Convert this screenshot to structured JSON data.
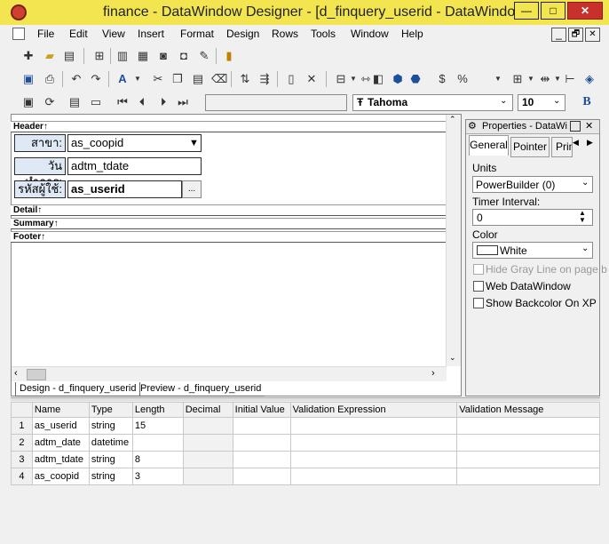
{
  "window": {
    "title": "finance - DataWindow Designer - [d_finquery_userid  - DataWindow]",
    "min_label": "—",
    "max_label": "□",
    "close_label": "✕"
  },
  "menu": {
    "items": [
      "File",
      "Edit",
      "View",
      "Insert",
      "Format",
      "Design",
      "Rows",
      "Tools",
      "Window",
      "Help"
    ],
    "child_min": "_",
    "child_restore": "🗗",
    "child_close": "✕"
  },
  "toolbar": {
    "font_name": "Tahoma",
    "font_size": "10",
    "bold_label": "B"
  },
  "bands": {
    "header": "Header↑",
    "detail": "Detail↑",
    "summary": "Summary↑",
    "footer": "Footer↑"
  },
  "header_fields": [
    {
      "label": "สาขา:",
      "value": "as_coopid"
    },
    {
      "label": "วันทำการ:",
      "value": "adtm_tdate"
    },
    {
      "label": "รหัสผู้ใช้:",
      "value": "as_userid",
      "button": "..."
    }
  ],
  "tabs": {
    "design": "Design - d_finquery_userid",
    "preview": "Preview - d_finquery_userid"
  },
  "properties": {
    "title": "Properties - DataWi",
    "tabs": [
      "General",
      "Pointer",
      "Prin"
    ],
    "units_label": "Units",
    "units_value": "PowerBuilder (0)",
    "timer_label": "Timer Interval:",
    "timer_value": "0",
    "color_label": "Color",
    "color_value": "White",
    "checks": [
      {
        "label": "Hide Gray Line on page b",
        "enabled": false
      },
      {
        "label": "Web DataWindow",
        "enabled": true
      },
      {
        "label": "Show Backcolor On XP",
        "enabled": true
      }
    ]
  },
  "columns_grid": {
    "headers": [
      "Name",
      "Type",
      "Length",
      "Decimal",
      "Initial Value",
      "Validation Expression",
      "Validation Message"
    ],
    "rows": [
      {
        "num": "1",
        "name": "as_userid",
        "type": "string",
        "length": "15"
      },
      {
        "num": "2",
        "name": "adtm_date",
        "type": "datetime",
        "length": ""
      },
      {
        "num": "3",
        "name": "adtm_tdate",
        "type": "string",
        "length": "8"
      },
      {
        "num": "4",
        "name": "as_coopid",
        "type": "string",
        "length": "3"
      }
    ]
  },
  "colors": {
    "titlebar": "#f2e54f",
    "label_bg": "#dfe9f6",
    "close": "#c8302b"
  }
}
